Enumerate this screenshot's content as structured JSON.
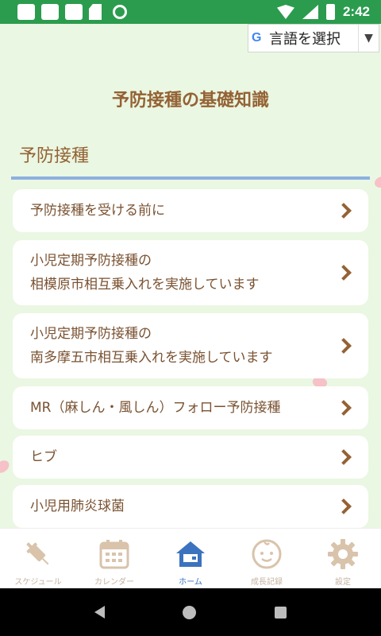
{
  "status_bar": {
    "time": "2:42"
  },
  "language_selector": {
    "label": "言語を選択",
    "arrow": "▼",
    "google_glyph": "G"
  },
  "page": {
    "title": "予防接種の基礎知識"
  },
  "section": {
    "title": "予防接種"
  },
  "menu": {
    "items": [
      {
        "label": "予防接種を受ける前に"
      },
      {
        "label": "小児定期予防接種の\n相模原市相互乗入れを実施しています"
      },
      {
        "label": "小児定期予防接種の\n南多摩五市相互乗入れを実施しています"
      },
      {
        "label": "MR（麻しん・風しん）フォロー予防接種"
      },
      {
        "label": "ヒブ"
      },
      {
        "label": "小児用肺炎球菌"
      }
    ]
  },
  "bottom_nav": {
    "tabs": [
      {
        "label": "スケジュール",
        "icon": "syringe-icon"
      },
      {
        "label": "カレンダー",
        "icon": "calendar-icon"
      },
      {
        "label": "ホーム",
        "icon": "home-icon",
        "active": true
      },
      {
        "label": "成長記録",
        "icon": "baby-face-icon"
      },
      {
        "label": "設定",
        "icon": "gear-icon"
      }
    ]
  },
  "colors": {
    "background": "#eaf7e2",
    "status_bar": "#2b9c4e",
    "title_brown": "#946235",
    "divider_blue": "#8db0df",
    "active_blue": "#3b73bf",
    "inactive_tan": "#d9c3ab"
  }
}
